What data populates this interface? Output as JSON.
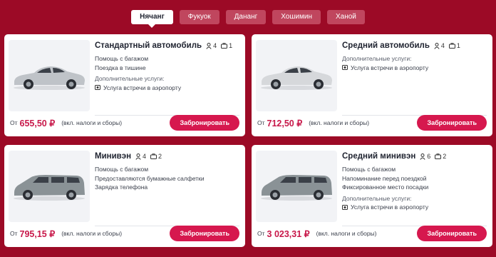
{
  "tabs": [
    {
      "label": "Нячанг",
      "active": true
    },
    {
      "label": "Фукуок",
      "active": false
    },
    {
      "label": "Дананг",
      "active": false
    },
    {
      "label": "Хошимин",
      "active": false
    },
    {
      "label": "Ханой",
      "active": false
    }
  ],
  "colors": {
    "background": "#9c0a26",
    "accent": "#d6184e",
    "price": "#c8184a"
  },
  "cards": [
    {
      "title": "Стандартный автомобиль",
      "passengers": "4",
      "luggage": "1",
      "features": [
        "Помощь с багажом",
        "Поездка в тишине"
      ],
      "extras_label": "Дополнительные услуги:",
      "extras": [
        "Услуга встречи в аэропорту"
      ],
      "price_from": "От",
      "price": "655,50 ₽",
      "tax_note": "(вкл. налоги и сборы)",
      "book_label": "Забронировать",
      "car_color": "#bfc3c8",
      "car_type": "sedan-icon"
    },
    {
      "title": "Средний автомобиль",
      "passengers": "4",
      "luggage": "1",
      "features": [],
      "extras_label": "Дополнительные услуги:",
      "extras": [
        "Услуга встречи в аэропорту"
      ],
      "price_from": "От",
      "price": "712,50 ₽",
      "tax_note": "(вкл. налоги и сборы)",
      "book_label": "Забронировать",
      "car_color": "#d6d8db",
      "car_type": "sedan-icon"
    },
    {
      "title": "Минивэн",
      "passengers": "4",
      "luggage": "2",
      "features": [
        "Помощь с багажом",
        "Предоставляются бумажные салфетки",
        "Зарядка телефона"
      ],
      "extras_label": "",
      "extras": [],
      "price_from": "От",
      "price": "795,15 ₽",
      "tax_note": "(вкл. налоги и сборы)",
      "book_label": "Забронировать",
      "car_color": "#8a9296",
      "car_type": "minivan-icon"
    },
    {
      "title": "Средний минивэн",
      "passengers": "6",
      "luggage": "2",
      "features": [
        "Помощь с багажом",
        "Напоминание перед поездкой",
        "Фиксированное место посадки"
      ],
      "extras_label": "Дополнительные услуги:",
      "extras": [
        "Услуга встречи в аэропорту"
      ],
      "price_from": "От",
      "price": "3 023,31 ₽",
      "tax_note": "(вкл. налоги и сборы)",
      "book_label": "Забронировать",
      "car_color": "#8a9296",
      "car_type": "minivan-icon"
    }
  ]
}
